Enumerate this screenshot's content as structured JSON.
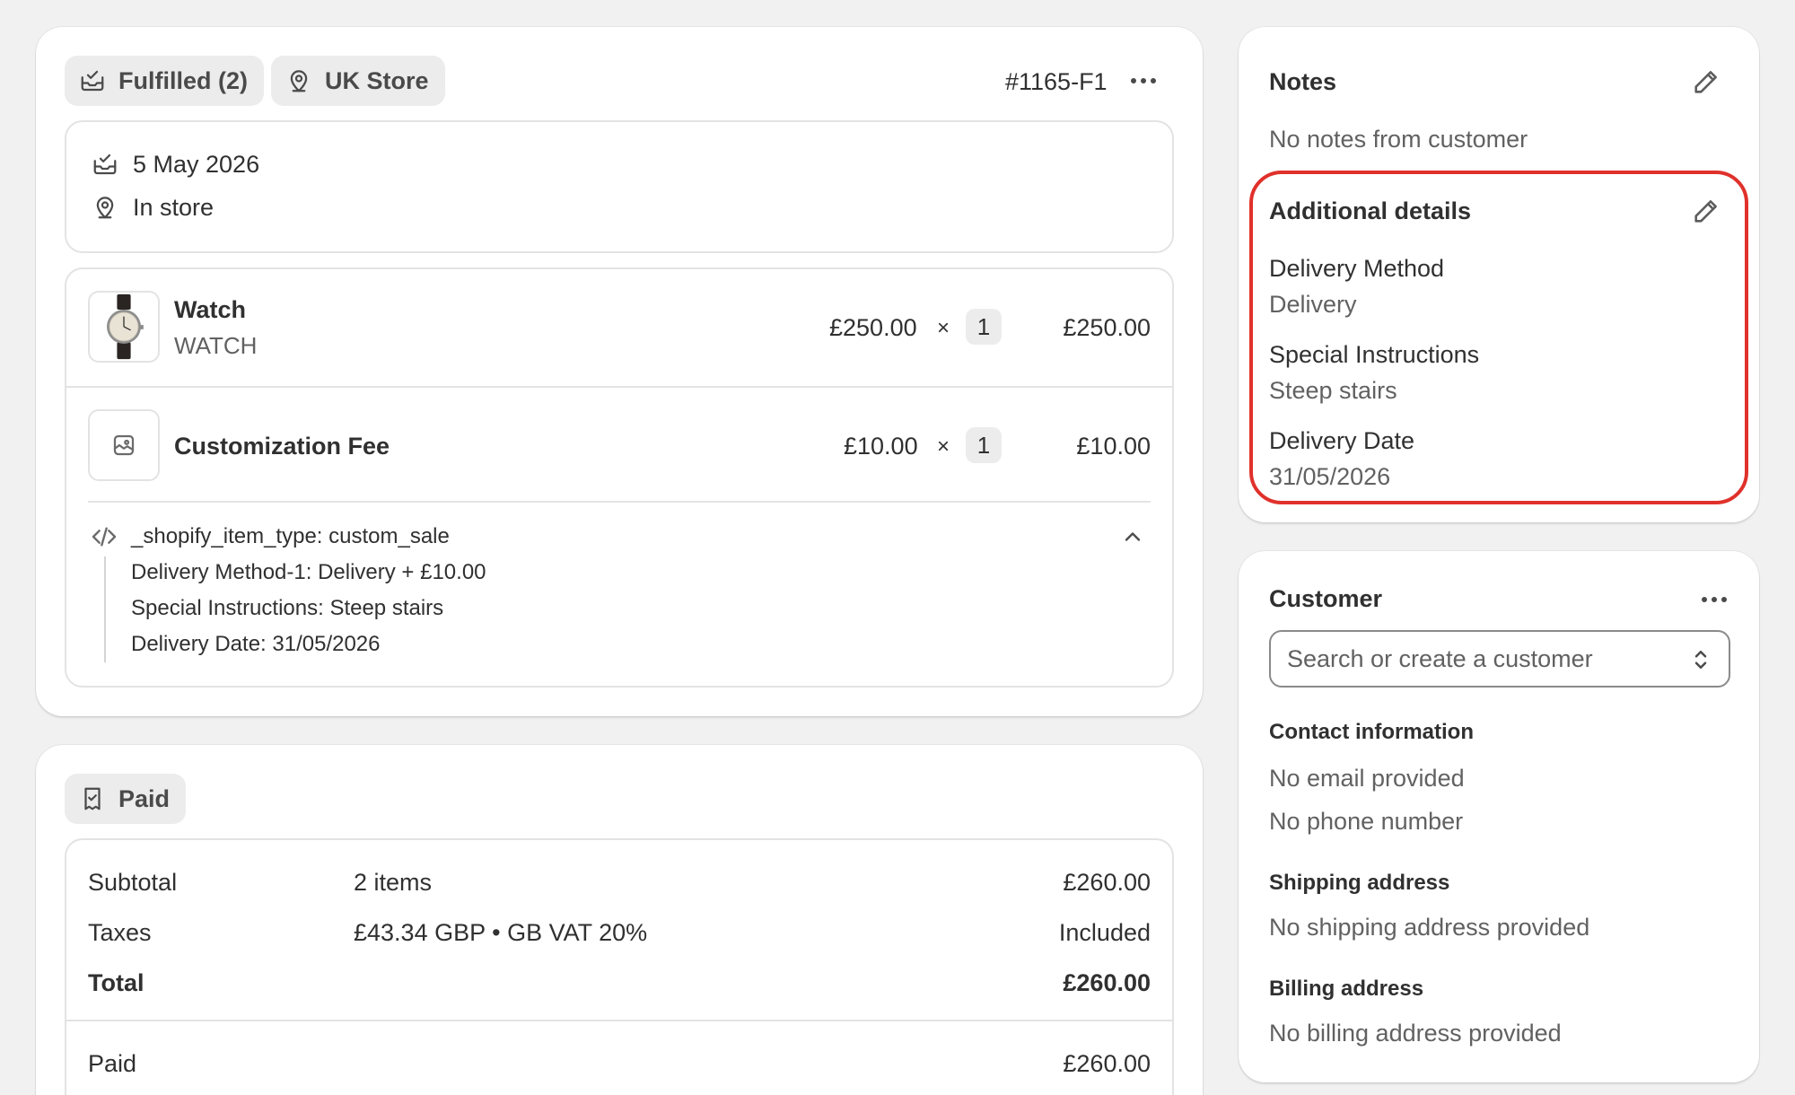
{
  "fulfillment": {
    "status_label": "Fulfilled (2)",
    "location_label": "UK Store",
    "order_id": "#1165-F1",
    "date": "5 May 2026",
    "method": "In store",
    "items": [
      {
        "name": "Watch",
        "sku": "WATCH",
        "unit_price": "£250.00",
        "times": "×",
        "qty": "1",
        "total": "£250.00"
      },
      {
        "name": "Customization Fee",
        "unit_price": "£10.00",
        "times": "×",
        "qty": "1",
        "total": "£10.00"
      }
    ],
    "properties": {
      "type_line": "_shopify_item_type: custom_sale",
      "lines": [
        "Delivery Method-1: Delivery + £10.00",
        "Special Instructions: Steep stairs",
        "Delivery Date: 31/05/2026"
      ]
    }
  },
  "payment": {
    "status_label": "Paid",
    "rows": [
      {
        "label": "Subtotal",
        "detail": "2 items",
        "value": "£260.00"
      },
      {
        "label": "Taxes",
        "detail": "£43.34 GBP • GB VAT 20%",
        "value": "Included"
      },
      {
        "label": "Total",
        "detail": "",
        "value": "£260.00"
      }
    ],
    "paid": {
      "label": "Paid",
      "value": "£260.00"
    }
  },
  "notes": {
    "title": "Notes",
    "text": "No notes from customer"
  },
  "additional_details": {
    "title": "Additional details",
    "fields": [
      {
        "label": "Delivery Method",
        "value": "Delivery"
      },
      {
        "label": "Special Instructions",
        "value": "Steep stairs"
      },
      {
        "label": "Delivery Date",
        "value": "31/05/2026"
      }
    ]
  },
  "customer": {
    "title": "Customer",
    "search_placeholder": "Search or create a customer",
    "contact_title": "Contact information",
    "email": "No email provided",
    "phone": "No phone number",
    "shipping_title": "Shipping address",
    "shipping_text": "No shipping address provided",
    "billing_title": "Billing address",
    "billing_text": "No billing address provided"
  },
  "colors": {
    "highlight": "#e0312b",
    "background": "#f1f1f1",
    "card": "#ffffff"
  }
}
